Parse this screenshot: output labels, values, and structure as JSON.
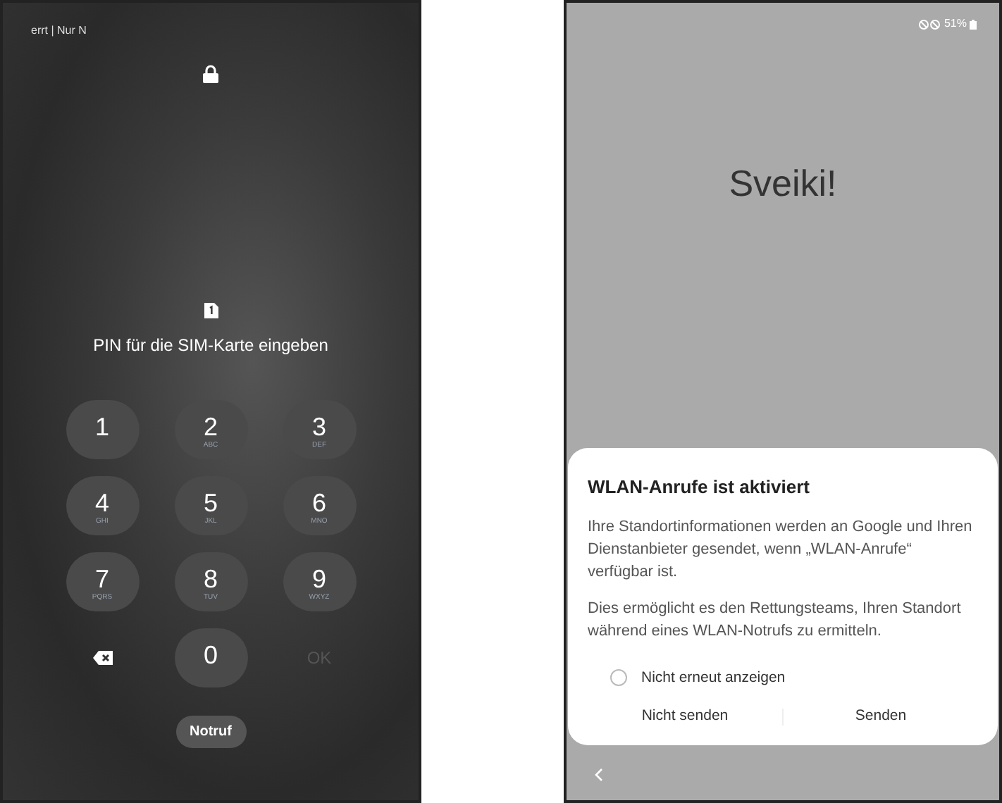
{
  "lock_screen": {
    "status_text": "errt | Nur N",
    "sim_prompt": "PIN für die SIM-Karte eingeben",
    "keys": [
      {
        "kind": "digit",
        "label": "1"
      },
      {
        "kind": "digit",
        "label": "2",
        "letters": "ABC"
      },
      {
        "kind": "digit",
        "label": "3",
        "letters": "DEF"
      },
      {
        "kind": "digit",
        "label": "4",
        "letters": "GHI"
      },
      {
        "kind": "digit",
        "label": "5",
        "letters": "JKL"
      },
      {
        "kind": "digit",
        "label": "6",
        "letters": "MNO"
      },
      {
        "kind": "digit",
        "label": "7",
        "letters": "PQRS"
      },
      {
        "kind": "digit",
        "label": "8",
        "letters": "TUV"
      },
      {
        "kind": "digit",
        "label": "9",
        "letters": "WXYZ"
      },
      {
        "kind": "backspace"
      },
      {
        "kind": "digit",
        "label": "0"
      },
      {
        "kind": "ok",
        "label": "OK",
        "disabled": true
      }
    ],
    "emergency_button": "Notruf"
  },
  "setup_screen": {
    "battery": "51%",
    "greeting": "Sveiki!",
    "dialog": {
      "title": "WLAN-Anrufe ist aktiviert",
      "paragraphs": [
        "Ihre Standortinformationen werden an Google und Ihren Dienstanbieter gesendet, wenn „WLAN-Anrufe“ verfügbar ist.",
        "Dies ermöglicht es den Rettungsteams, Ihren Standort während eines WLAN-Notrufs zu ermitteln."
      ],
      "checkbox": {
        "label": "Nicht erneut anzeigen",
        "checked": false
      },
      "buttons": [
        "Nicht senden",
        "Senden"
      ]
    }
  }
}
